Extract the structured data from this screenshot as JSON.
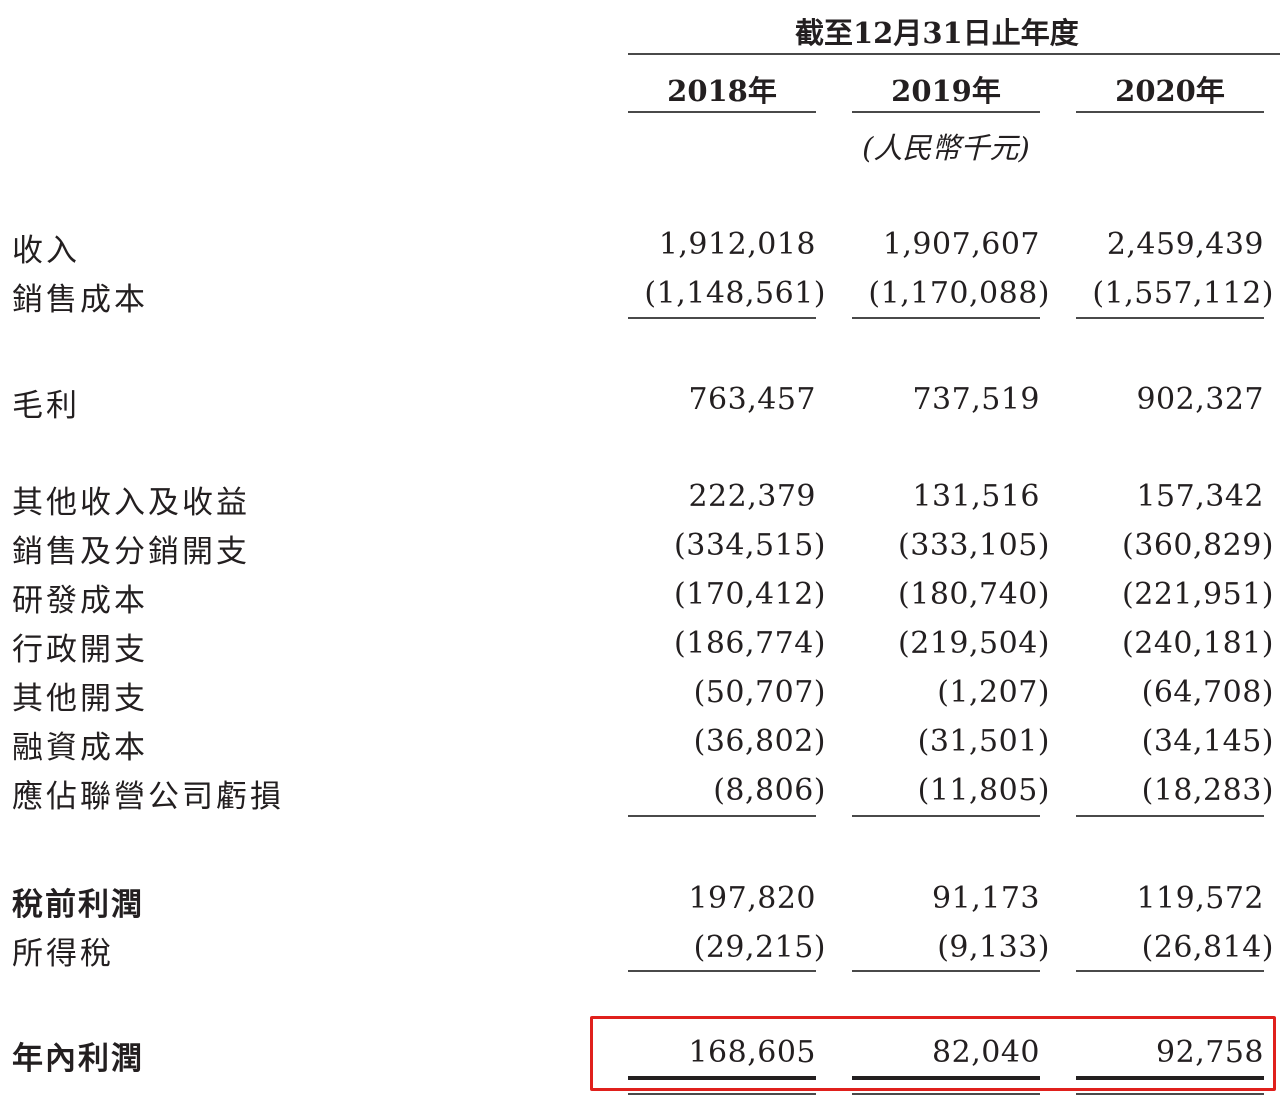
{
  "header": {
    "period_title": "截至12月31日止年度",
    "years": [
      "2018年",
      "2019年",
      "2020年"
    ],
    "unit": "(人民幣千元)"
  },
  "rows": [
    {
      "label": "收入",
      "values": [
        "1,912,018",
        "1,907,607",
        "2,459,439"
      ]
    },
    {
      "label": "銷售成本",
      "values": [
        "(1,148,561)",
        "(1,170,088)",
        "(1,557,112)"
      ]
    },
    {
      "label": "毛利",
      "values": [
        "763,457",
        "737,519",
        "902,327"
      ]
    },
    {
      "label": "其他收入及收益",
      "values": [
        "222,379",
        "131,516",
        "157,342"
      ]
    },
    {
      "label": "銷售及分銷開支",
      "values": [
        "(334,515)",
        "(333,105)",
        "(360,829)"
      ]
    },
    {
      "label": "研發成本",
      "values": [
        "(170,412)",
        "(180,740)",
        "(221,951)"
      ]
    },
    {
      "label": "行政開支",
      "values": [
        "(186,774)",
        "(219,504)",
        "(240,181)"
      ]
    },
    {
      "label": "其他開支",
      "values": [
        "(50,707)",
        "(1,207)",
        "(64,708)"
      ]
    },
    {
      "label": "融資成本",
      "values": [
        "(36,802)",
        "(31,501)",
        "(34,145)"
      ]
    },
    {
      "label": "應佔聯營公司虧損",
      "values": [
        "(8,806)",
        "(11,805)",
        "(18,283)"
      ]
    },
    {
      "label": "稅前利潤",
      "values": [
        "197,820",
        "91,173",
        "119,572"
      ]
    },
    {
      "label": "所得稅",
      "values": [
        "(29,215)",
        "(9,133)",
        "(26,814)"
      ]
    },
    {
      "label": "年內利潤",
      "values": [
        "168,605",
        "82,040",
        "92,758"
      ]
    }
  ],
  "colors": {
    "text": "#231f20",
    "rule": "#4a4a4a",
    "highlight_border": "#e0201c"
  }
}
